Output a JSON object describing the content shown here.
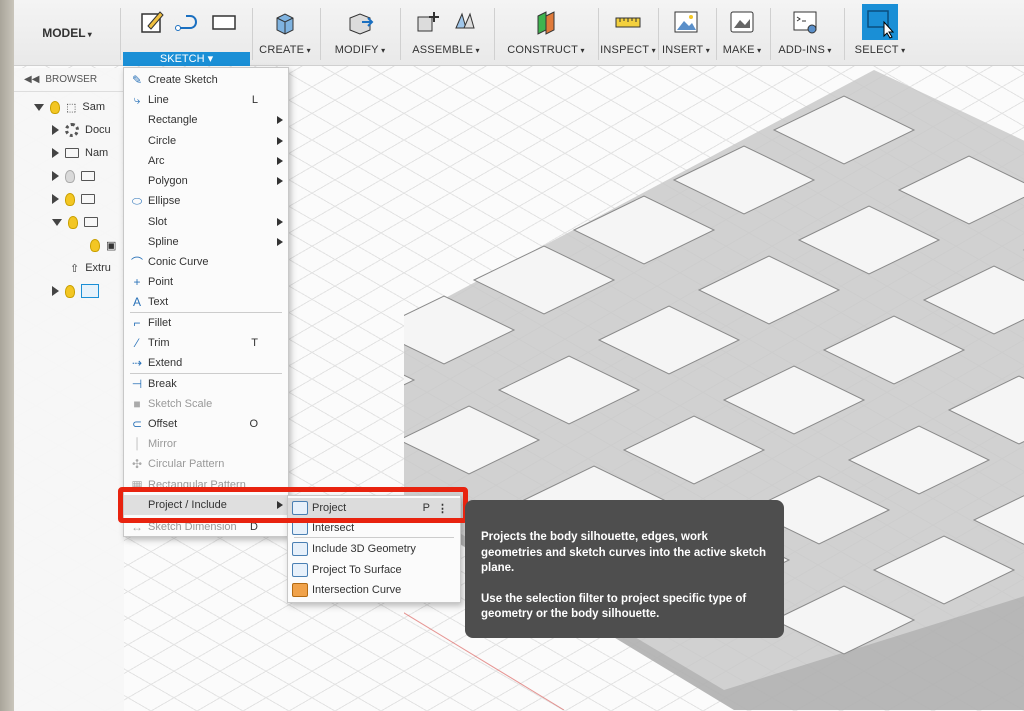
{
  "toolbar": {
    "workspace": "MODEL",
    "groups": [
      {
        "label": "SKETCH",
        "icons": [
          "create-sketch-icon",
          "line-icon",
          "rectangle-icon"
        ],
        "active": true
      },
      {
        "label": "CREATE",
        "icons": [
          "box-extrude-icon"
        ]
      },
      {
        "label": "MODIFY",
        "icons": [
          "press-pull-icon"
        ]
      },
      {
        "label": "ASSEMBLE",
        "icons": [
          "new-component-icon",
          "joint-icon"
        ]
      },
      {
        "label": "CONSTRUCT",
        "icons": [
          "offset-plane-icon"
        ]
      },
      {
        "label": "INSPECT",
        "icons": [
          "measure-icon"
        ]
      },
      {
        "label": "INSERT",
        "icons": [
          "insert-image-icon"
        ]
      },
      {
        "label": "MAKE",
        "icons": [
          "print-3d-icon"
        ]
      },
      {
        "label": "ADD-INS",
        "icons": [
          "scripts-icon"
        ]
      },
      {
        "label": "SELECT",
        "icons": [
          "select-cursor-icon"
        ]
      }
    ]
  },
  "browser": {
    "title": "BROWSER",
    "rows": [
      {
        "label": "Sam",
        "icons": [
          "bulb",
          "doc"
        ]
      },
      {
        "label": "Docu",
        "icons": [
          "gear"
        ]
      },
      {
        "label": "Nam",
        "icons": [
          "folder"
        ]
      },
      {
        "label": "",
        "icons": [
          "bulb",
          "folder"
        ]
      },
      {
        "label": "",
        "icons": [
          "bulb",
          "folder"
        ]
      },
      {
        "label": "",
        "icons": [
          "bulb",
          "folder"
        ]
      },
      {
        "label": "",
        "icons": [
          "bulb",
          "sketch"
        ]
      },
      {
        "label": "Extru",
        "icons": [
          "extrude"
        ]
      },
      {
        "label": "",
        "icons": [
          "bulb",
          "body"
        ]
      }
    ]
  },
  "menu": {
    "items": [
      {
        "label": "Create Sketch",
        "shortcut": "",
        "submenu": false,
        "disabled": false
      },
      {
        "label": "Line",
        "shortcut": "L",
        "submenu": false,
        "disabled": false
      },
      {
        "label": "Rectangle",
        "shortcut": "",
        "submenu": true,
        "disabled": false
      },
      {
        "label": "Circle",
        "shortcut": "",
        "submenu": true,
        "disabled": false
      },
      {
        "label": "Arc",
        "shortcut": "",
        "submenu": true,
        "disabled": false
      },
      {
        "label": "Polygon",
        "shortcut": "",
        "submenu": true,
        "disabled": false
      },
      {
        "label": "Ellipse",
        "shortcut": "",
        "submenu": false,
        "disabled": false
      },
      {
        "label": "Slot",
        "shortcut": "",
        "submenu": true,
        "disabled": false
      },
      {
        "label": "Spline",
        "shortcut": "",
        "submenu": true,
        "disabled": false
      },
      {
        "label": "Conic Curve",
        "shortcut": "",
        "submenu": false,
        "disabled": false
      },
      {
        "label": "Point",
        "shortcut": "",
        "submenu": false,
        "disabled": false
      },
      {
        "label": "Text",
        "shortcut": "",
        "submenu": false,
        "disabled": false
      },
      {
        "label": "Fillet",
        "shortcut": "",
        "submenu": false,
        "disabled": false
      },
      {
        "label": "Trim",
        "shortcut": "T",
        "submenu": false,
        "disabled": false
      },
      {
        "label": "Extend",
        "shortcut": "",
        "submenu": false,
        "disabled": false
      },
      {
        "label": "Break",
        "shortcut": "",
        "submenu": false,
        "disabled": false
      },
      {
        "label": "Sketch Scale",
        "shortcut": "",
        "submenu": false,
        "disabled": true
      },
      {
        "label": "Offset",
        "shortcut": "O",
        "submenu": false,
        "disabled": false
      },
      {
        "label": "Mirror",
        "shortcut": "",
        "submenu": false,
        "disabled": true
      },
      {
        "label": "Circular Pattern",
        "shortcut": "",
        "submenu": false,
        "disabled": true
      },
      {
        "label": "Rectangular Pattern",
        "shortcut": "",
        "submenu": false,
        "disabled": true
      },
      {
        "label": "Project / Include",
        "shortcut": "",
        "submenu": true,
        "disabled": false,
        "highlighted": true
      },
      {
        "label": "Sketch Dimension",
        "shortcut": "D",
        "submenu": false,
        "disabled": true
      }
    ]
  },
  "submenu": {
    "items": [
      {
        "label": "Project",
        "shortcut": "P",
        "highlighted": true
      },
      {
        "label": "Intersect",
        "shortcut": ""
      },
      {
        "label": "Include 3D Geometry",
        "shortcut": ""
      },
      {
        "label": "Project To Surface",
        "shortcut": ""
      },
      {
        "label": "Intersection Curve",
        "shortcut": ""
      }
    ]
  },
  "tooltip": {
    "para1": "Projects the body silhouette, edges, work geometries and sketch curves into the active sketch plane.",
    "para2": "Use the selection filter to project specific type of geometry or the body silhouette."
  },
  "colors": {
    "accent": "#1a8fd6",
    "highlight_box": "#e8230f",
    "select_button": "#1a8fd6"
  }
}
